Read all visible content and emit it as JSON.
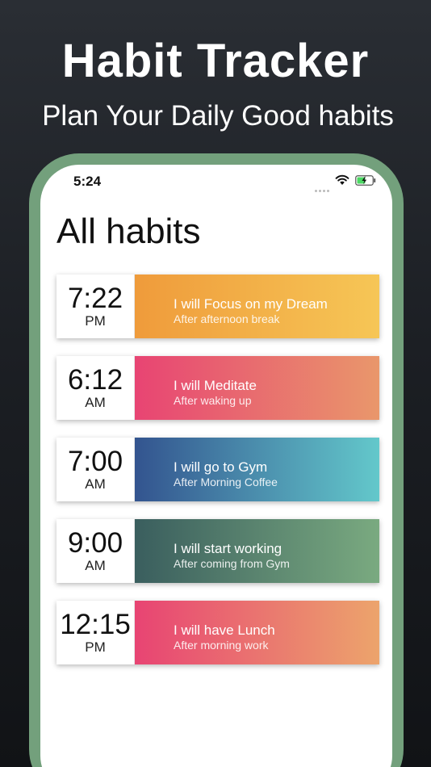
{
  "promo": {
    "title": "Habit Tracker",
    "subtitle": "Plan Your Daily Good habits"
  },
  "status_bar": {
    "time": "5:24",
    "icons": [
      "signal-dots-icon",
      "wifi-icon",
      "battery-charging-icon"
    ]
  },
  "page": {
    "title": "All habits"
  },
  "habits": [
    {
      "time": "7:22",
      "ampm": "PM",
      "name": "I will Focus on my Dream",
      "trigger": "After afternoon break"
    },
    {
      "time": "6:12",
      "ampm": "AM",
      "name": "I will Meditate",
      "trigger": "After waking up"
    },
    {
      "time": "7:00",
      "ampm": "AM",
      "name": "I will go to Gym",
      "trigger": "After Morning Coffee"
    },
    {
      "time": "9:00",
      "ampm": "AM",
      "name": "I will start working",
      "trigger": "After coming from Gym"
    },
    {
      "time": "12:15",
      "ampm": "PM",
      "name": "I will have Lunch",
      "trigger": "After morning work"
    }
  ],
  "colors": {
    "phone_frame": "#73a07c",
    "card_gradients": [
      [
        "#ef9b3b",
        "#f6c656"
      ],
      [
        "#e84473",
        "#e9976b"
      ],
      [
        "#33548f",
        "#63c8cb"
      ],
      [
        "#3a5e5e",
        "#7aaa80"
      ],
      [
        "#e84473",
        "#eca46c"
      ]
    ]
  }
}
